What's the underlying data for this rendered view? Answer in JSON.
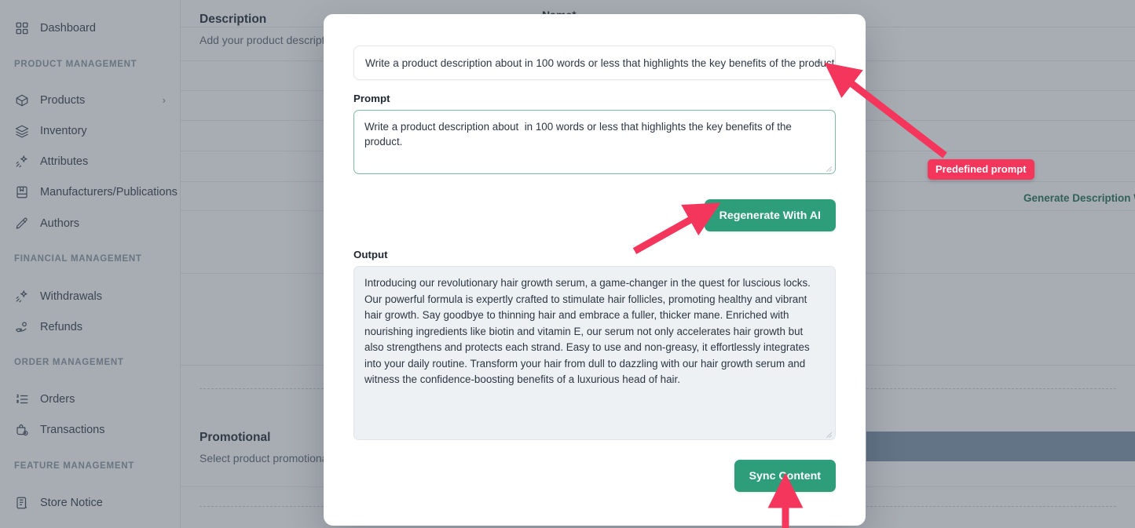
{
  "sidebar": {
    "items": [
      {
        "type": "link",
        "label": "Dashboard",
        "icon": "grid-icon",
        "chevron": ""
      },
      {
        "type": "section",
        "label": "PRODUCT MANAGEMENT",
        "icon": "",
        "chevron": ""
      },
      {
        "type": "link",
        "label": "Products",
        "icon": "box-icon",
        "chevron": "›"
      },
      {
        "type": "link",
        "label": "Inventory",
        "icon": "layers-icon",
        "chevron": ""
      },
      {
        "type": "link",
        "label": "Attributes",
        "icon": "sparkle-icon",
        "chevron": ""
      },
      {
        "type": "link",
        "label": "Manufacturers/Publications",
        "icon": "book-icon",
        "chevron": ""
      },
      {
        "type": "link",
        "label": "Authors",
        "icon": "pen-icon",
        "chevron": ""
      },
      {
        "type": "section",
        "label": "FINANCIAL MANAGEMENT",
        "icon": "",
        "chevron": ""
      },
      {
        "type": "link",
        "label": "Withdrawals",
        "icon": "sparkle-icon",
        "chevron": ""
      },
      {
        "type": "link",
        "label": "Refunds",
        "icon": "hand-coin-icon",
        "chevron": ""
      },
      {
        "type": "section",
        "label": "ORDER MANAGEMENT",
        "icon": "",
        "chevron": ""
      },
      {
        "type": "link",
        "label": "Orders",
        "icon": "ordered-list-icon",
        "chevron": ""
      },
      {
        "type": "link",
        "label": "Transactions",
        "icon": "bag-clock-icon",
        "chevron": ""
      },
      {
        "type": "section",
        "label": "FEATURE MANAGEMENT",
        "icon": "",
        "chevron": ""
      },
      {
        "type": "link",
        "label": "Store Notice",
        "icon": "notice-icon",
        "chevron": ""
      }
    ]
  },
  "background_form": {
    "description_section": {
      "title": "Description",
      "subtitle": "Add your product description"
    },
    "promotional_section": {
      "title": "Promotional",
      "subtitle": "Select product promotional s"
    },
    "name_label": "Name*",
    "generate_link": "Generate Description Wit"
  },
  "modal": {
    "predefined_select": {
      "value": "Write a product description about in 100 words or less that highlights the key benefits of the product.",
      "chevron_icon": "chevron-down-icon"
    },
    "prompt": {
      "label": "Prompt",
      "value": "Write a product description about  in 100 words or less that highlights the key benefits of the product."
    },
    "regenerate_button": "Regenerate With AI",
    "output": {
      "label": "Output",
      "value": "Introducing our revolutionary hair growth serum, a game-changer in the quest for luscious locks. Our powerful formula is expertly crafted to stimulate hair follicles, promoting healthy and vibrant hair growth. Say goodbye to thinning hair and embrace a fuller, thicker mane. Enriched with nourishing ingredients like biotin and vitamin E, our serum not only accelerates hair growth but also strengthens and protects each strand. Easy to use and non-greasy, it effortlessly integrates into your daily routine. Transform your hair from dull to dazzling with our hair growth serum and witness the confidence-boosting benefits of a luxurious head of hair."
    },
    "sync_button": "Sync Content"
  },
  "annotations": {
    "predefined_prompt_badge": "Predefined prompt"
  },
  "colors": {
    "accent_green": "#2e9e7a",
    "annotation_pink": "#f5365c",
    "scrim": "rgba(71,80,94,.47)",
    "highlight_band": "#7e93ad",
    "prompt_border": "#7fb9a1",
    "output_bg": "#eef1f4"
  }
}
